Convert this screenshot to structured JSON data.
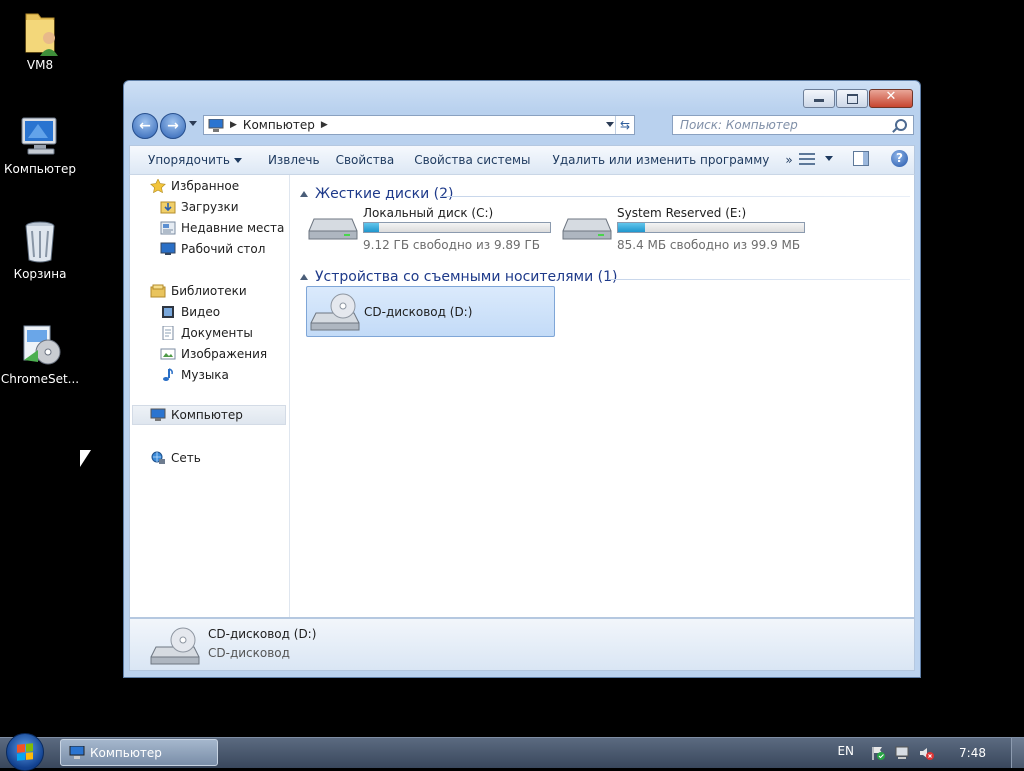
{
  "desktop": {
    "icons": [
      {
        "name": "VM8"
      },
      {
        "name": "Компьютер"
      },
      {
        "name": "Корзина"
      },
      {
        "name": "ChromeSet..."
      }
    ]
  },
  "window": {
    "address": {
      "location": "Компьютер"
    },
    "search": {
      "placeholder": "Поиск: Компьютер"
    },
    "toolbar": {
      "organize": "Упорядочить",
      "eject": "Извлечь",
      "properties": "Свойства",
      "system_properties": "Свойства системы",
      "uninstall": "Удалить или изменить программу",
      "more": "»"
    },
    "nav_pane": {
      "favorites": "Избранное",
      "downloads": "Загрузки",
      "recent": "Недавние места",
      "desktop": "Рабочий стол",
      "libraries": "Библиотеки",
      "video": "Видео",
      "documents": "Документы",
      "pictures": "Изображения",
      "music": "Музыка",
      "computer": "Компьютер",
      "network": "Сеть"
    },
    "groups": {
      "hard_disks": "Жесткие диски (2)",
      "removable": "Устройства со съемными носителями (1)"
    },
    "drives": {
      "c": {
        "name": "Локальный диск (C:)",
        "free_text": "9.12 ГБ свободно из 9.89 ГБ",
        "used_fraction": 0.078
      },
      "e": {
        "name": "System Reserved (E:)",
        "free_text": "85.4 МБ свободно из 99.9 МБ",
        "used_fraction": 0.145
      },
      "d": {
        "name": "CD-дисковод (D:)"
      }
    },
    "details": {
      "name": "CD-дисковод (D:)",
      "type": "CD-дисковод"
    }
  },
  "taskbar": {
    "task_label": "Компьютер",
    "lang": "EN",
    "clock": "7:48"
  },
  "colors": {
    "usage_bar": "#26a0da",
    "selection": "#cde1f8",
    "group_header": "#1e3a8a"
  }
}
